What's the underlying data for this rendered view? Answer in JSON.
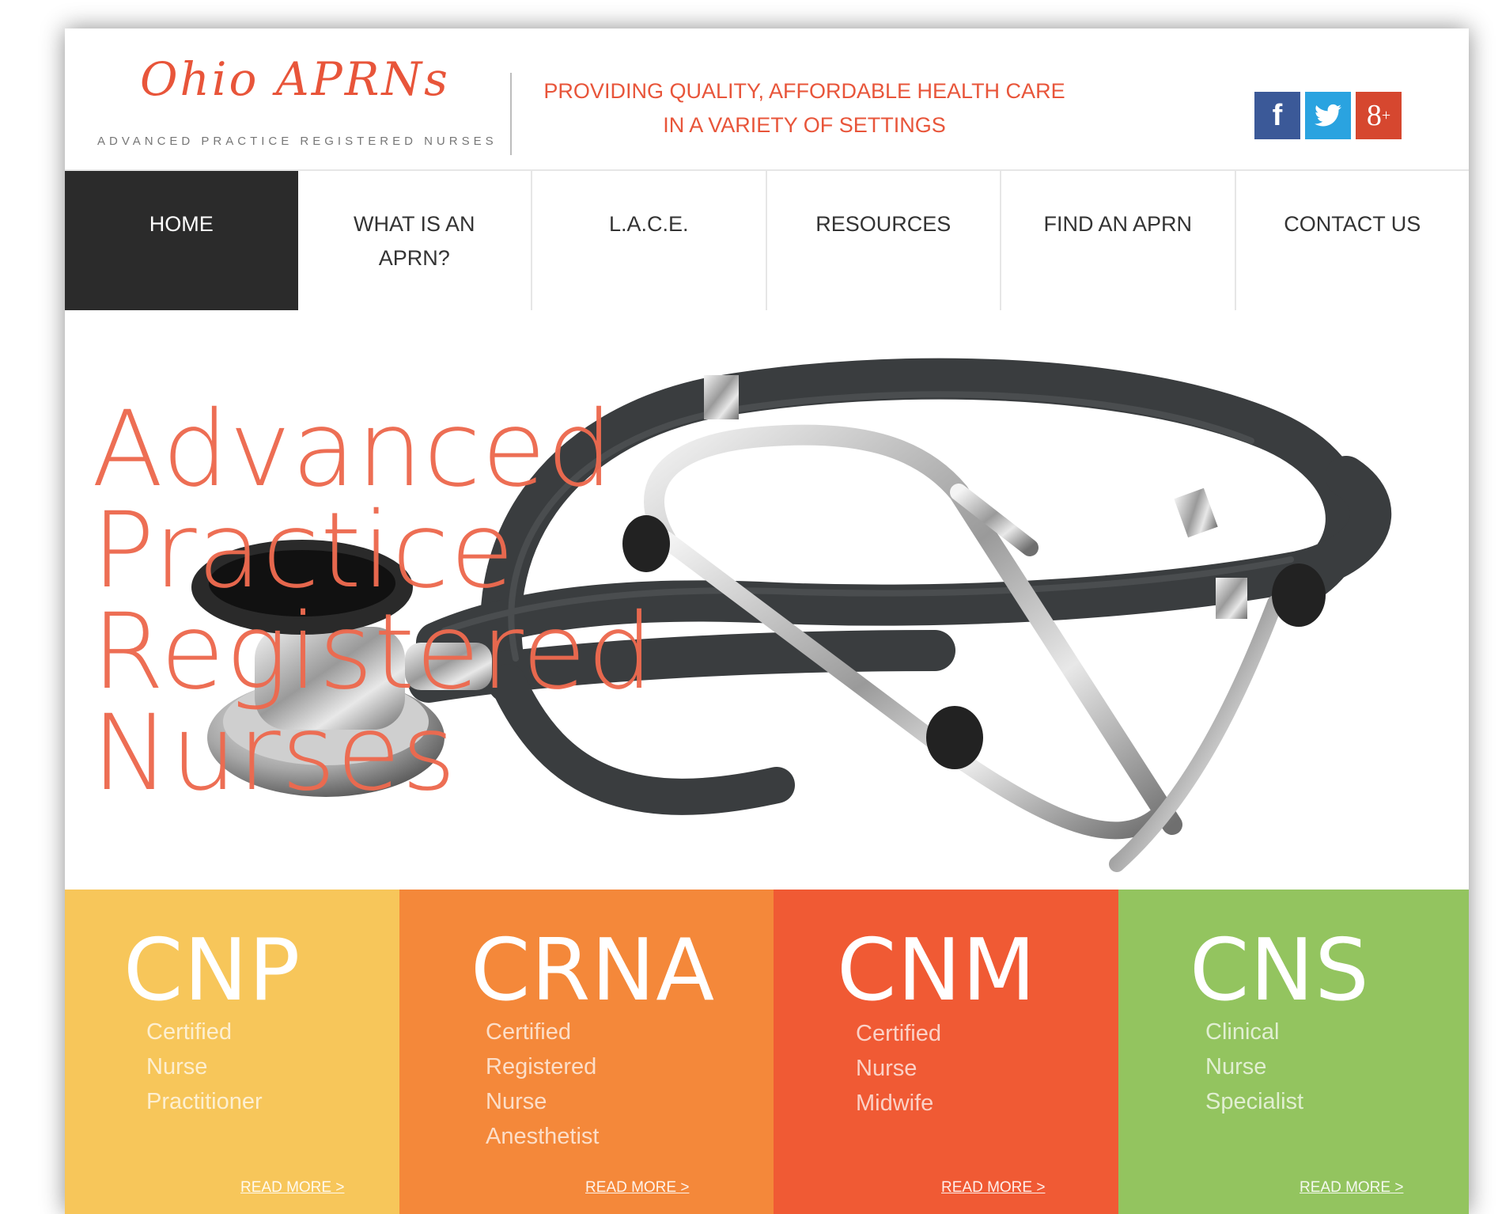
{
  "header": {
    "logo_title": "Ohio APRNs",
    "logo_subtitle": "ADVANCED PRACTICE REGISTERED NURSES",
    "tagline_line1": "PROVIDING QUALITY, AFFORDABLE HEALTH CARE",
    "tagline_line2": "IN A VARIETY OF SETTINGS",
    "social": [
      {
        "icon": "facebook-icon",
        "glyph": "f"
      },
      {
        "icon": "twitter-icon",
        "glyph": "🐦"
      },
      {
        "icon": "google-plus-icon",
        "glyph": "8"
      }
    ]
  },
  "nav": {
    "items": [
      {
        "label": "HOME",
        "active": true
      },
      {
        "label": "WHAT IS AN APRN?"
      },
      {
        "label": "L.A.C.E."
      },
      {
        "label": "RESOURCES"
      },
      {
        "label": "FIND AN APRN"
      },
      {
        "label": "CONTACT US"
      }
    ]
  },
  "hero": {
    "title_lines": [
      "Advanced",
      "Practice",
      "Registered",
      "Nurses"
    ]
  },
  "roles": [
    {
      "abbr": "CNP",
      "full_lines": [
        "Certified",
        "Nurse",
        "Practitioner"
      ],
      "more": "READ MORE >",
      "color": "#f7c65a"
    },
    {
      "abbr": "CRNA",
      "full_lines": [
        "Certified",
        "Registered",
        "Nurse",
        "Anesthetist"
      ],
      "more": "READ MORE >",
      "color": "#f4883a"
    },
    {
      "abbr": "CNM",
      "full_lines": [
        "Certified",
        "Nurse",
        "Midwife"
      ],
      "more": "READ MORE >",
      "color": "#f05a34"
    },
    {
      "abbr": "CNS",
      "full_lines": [
        "Clinical",
        "Nurse",
        "Specialist"
      ],
      "more": "READ MORE >",
      "color": "#93c45f"
    }
  ],
  "colors": {
    "accent": "#e8553a",
    "nav_active_bg": "#2b2b2b"
  }
}
